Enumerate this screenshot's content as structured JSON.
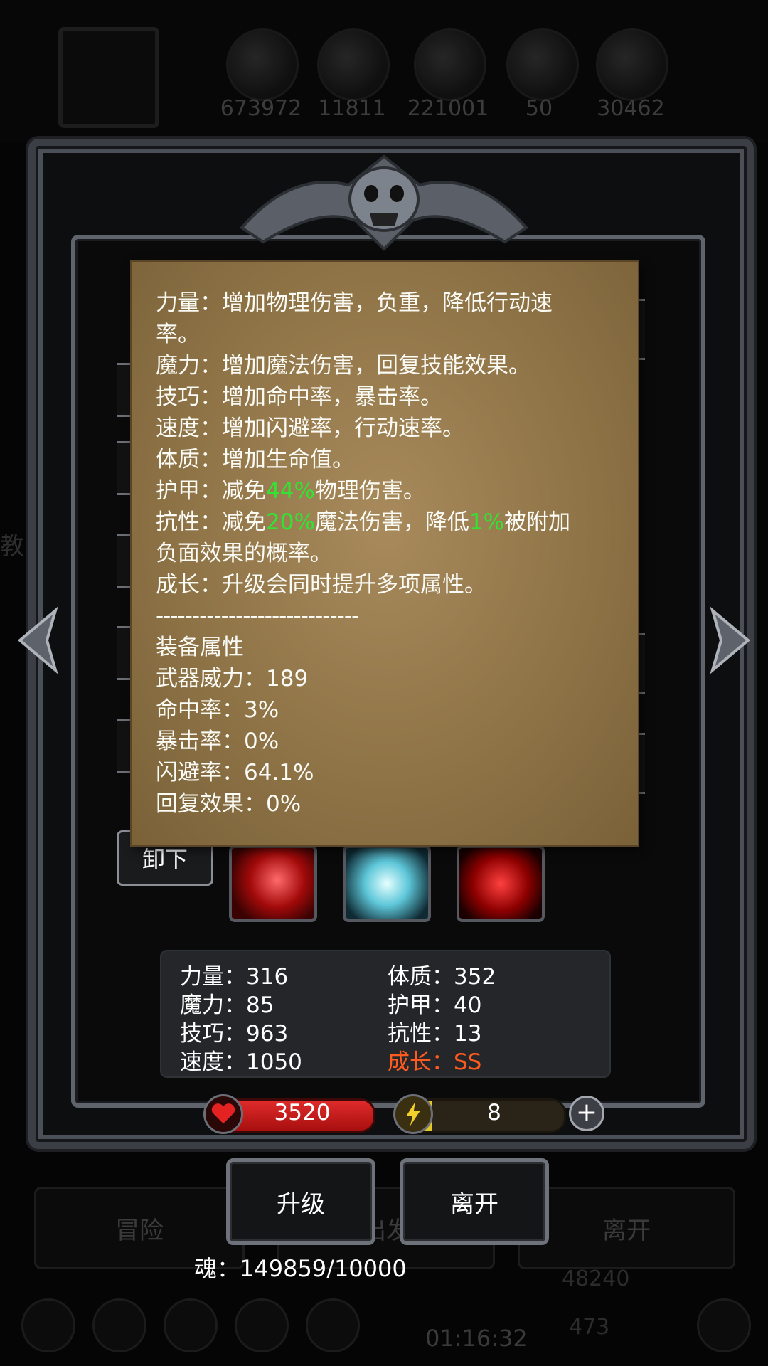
{
  "resources": {
    "values": [
      "673972",
      "11811",
      "221001",
      "50",
      "30462"
    ]
  },
  "background": {
    "left_button": "冒险",
    "middle_button_partial": "出发",
    "right_button": "离开",
    "left_label_partial": "教",
    "bottom_value_1": "48240",
    "bottom_value_2": "473",
    "timer": "01:16:32"
  },
  "tooltip": {
    "lines": [
      {
        "pre": "力量：增加物理伤害，负重，降低行动速"
      },
      {
        "pre": "率。"
      },
      {
        "pre": "魔力：增加魔法伤害，回复技能效果。"
      },
      {
        "pre": "技巧：增加命中率，暴击率。"
      },
      {
        "pre": "速度：增加闪避率，行动速率。"
      },
      {
        "pre": "体质：增加生命值。"
      },
      {
        "pre": "护甲：减免",
        "hl": "44%",
        "post": "物理伤害。"
      },
      {
        "pre": "抗性：减免",
        "hl": "20%",
        "post": "魔法伤害，降低",
        "hl2": "1%",
        "post2": "被附加"
      },
      {
        "pre": "负面效果的概率。"
      },
      {
        "pre": "成长：升级会同时提升多项属性。"
      },
      {
        "pre": "----------------------------"
      },
      {
        "pre": "装备属性"
      },
      {
        "pre": "武器威力：189"
      },
      {
        "pre": "命中率：3%"
      },
      {
        "pre": "暴击率：0%"
      },
      {
        "pre": "闪避率：64.1%"
      },
      {
        "pre": "回复效果：0%"
      }
    ],
    "highlight_color": "#34e234"
  },
  "equipment": {
    "unequip_label": "卸下",
    "skills": [
      "red-slash-skill-icon",
      "ice-swirl-skill-icon",
      "flame-blade-skill-icon"
    ]
  },
  "stats": {
    "left": [
      "力量：316",
      "魔力：85",
      "技巧：963",
      "速度：1050"
    ],
    "right": [
      "体质：352",
      "护甲：40",
      "抗性：13"
    ],
    "growth": "成长：SS",
    "growth_color": "#ff5a1f"
  },
  "bars": {
    "hp": "3520",
    "energy": "8",
    "energy_fill_fraction": 0.08
  },
  "actions": {
    "upgrade": "升级",
    "leave": "离开"
  },
  "soul": "魂：149859/10000"
}
